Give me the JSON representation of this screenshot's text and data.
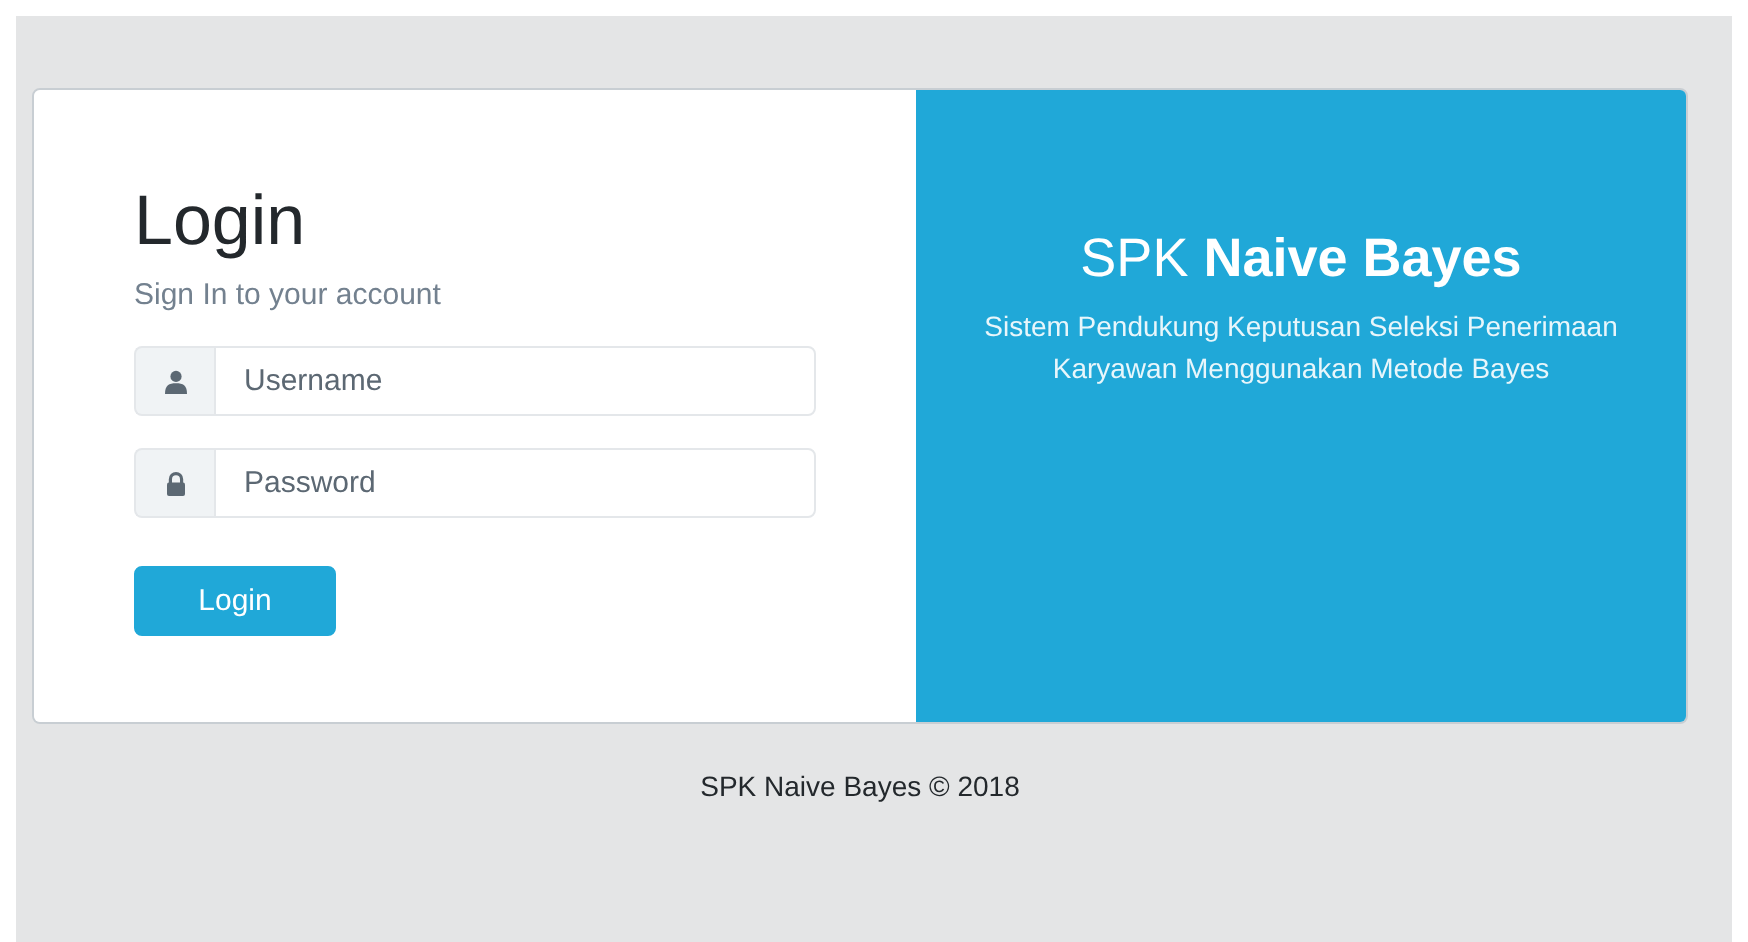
{
  "login": {
    "title": "Login",
    "subtitle": "Sign In to your account",
    "fields": [
      {
        "kind": "user",
        "placeholder": "Username"
      },
      {
        "kind": "lock",
        "placeholder": "Password"
      }
    ],
    "button": "Login"
  },
  "brand": {
    "title": "SPK **Naive Bayes**",
    "description": "Sistem Pendukung Keputusan Seleksi Penerimaan Karyawan Menggunakan Metode Bayes"
  },
  "footer": "SPK Naive Bayes © 2018"
}
